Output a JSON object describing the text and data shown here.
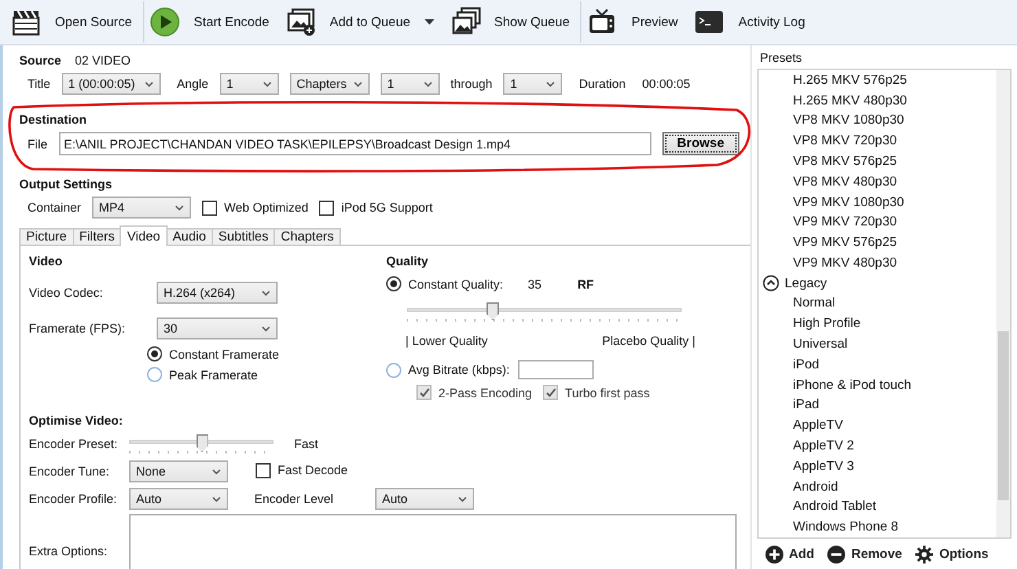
{
  "toolbar": [
    {
      "label": "Open Source",
      "dropdown": false
    },
    {
      "label": "Start Encode",
      "dropdown": false
    },
    {
      "label": "Add to Queue",
      "dropdown": true
    },
    {
      "label": "Show Queue",
      "dropdown": false
    },
    {
      "label": "Preview",
      "dropdown": false
    },
    {
      "label": "Activity Log",
      "dropdown": false
    }
  ],
  "source": {
    "label": "Source",
    "value": "02 VIDEO",
    "title_label": "Title",
    "title": "1 (00:00:05)",
    "angle_label": "Angle",
    "angle": "1",
    "range_mode": "Chapters",
    "range_start": "1",
    "through_label": "through",
    "range_end": "1",
    "duration_label": "Duration",
    "duration": "00:00:05"
  },
  "destination": {
    "label": "Destination",
    "file_label": "File",
    "file": "E:\\ANIL PROJECT\\CHANDAN VIDEO TASK\\EPILEPSY\\Broadcast Design 1.mp4",
    "browse": "Browse",
    "annotated": true
  },
  "output": {
    "label": "Output Settings",
    "container_label": "Container",
    "container": "MP4",
    "options": [
      {
        "label": "Web Optimized",
        "checked": false
      },
      {
        "label": "iPod 5G Support",
        "checked": false
      }
    ]
  },
  "tabs": [
    {
      "label": "Picture",
      "selected": false
    },
    {
      "label": "Filters",
      "selected": false
    },
    {
      "label": "Video",
      "selected": true
    },
    {
      "label": "Audio",
      "selected": false
    },
    {
      "label": "Subtitles",
      "selected": false
    },
    {
      "label": "Chapters",
      "selected": false
    }
  ],
  "video": {
    "heading": "Video",
    "codec_label": "Video Codec:",
    "codec": "H.264 (x264)",
    "fps_label": "Framerate (FPS):",
    "fps": "30",
    "rate_modes": [
      {
        "label": "Constant Framerate",
        "selected": true
      },
      {
        "label": "Peak Framerate",
        "selected": false
      }
    ]
  },
  "quality": {
    "heading": "Quality",
    "modes": [
      {
        "label": "Constant Quality:",
        "selected": true
      },
      {
        "label": "Avg Bitrate (kbps):",
        "selected": false
      }
    ],
    "value": "35",
    "unit": "RF",
    "level": 0.31,
    "low_label": "| Lower Quality",
    "high_label": "Placebo Quality |",
    "passes": [
      {
        "label": "2-Pass Encoding",
        "checked": true,
        "disabled": true
      },
      {
        "label": "Turbo first pass",
        "checked": true,
        "disabled": true
      }
    ]
  },
  "optimise": {
    "heading": "Optimise Video:",
    "preset_label": "Encoder Preset:",
    "level": 0.5,
    "preset_value": "Fast",
    "tune_label": "Encoder Tune:",
    "tune": "None",
    "fast_decode": {
      "label": "Fast Decode",
      "checked": false
    },
    "profile_label": "Encoder Profile:",
    "profile": "Auto",
    "level_label": "Encoder Level",
    "level_value": "Auto",
    "extra_label": "Extra Options:"
  },
  "presets": {
    "label": "Presets",
    "items": [
      {
        "kind": "item",
        "label": "H.265 MKV 576p25"
      },
      {
        "kind": "item",
        "label": "H.265 MKV 480p30"
      },
      {
        "kind": "item",
        "label": "VP8 MKV 1080p30"
      },
      {
        "kind": "item",
        "label": "VP8 MKV 720p30"
      },
      {
        "kind": "item",
        "label": "VP8 MKV 576p25"
      },
      {
        "kind": "item",
        "label": "VP8 MKV 480p30"
      },
      {
        "kind": "item",
        "label": "VP9 MKV 1080p30"
      },
      {
        "kind": "item",
        "label": "VP9 MKV 720p30"
      },
      {
        "kind": "item",
        "label": "VP9 MKV 576p25"
      },
      {
        "kind": "item",
        "label": "VP9 MKV 480p30"
      },
      {
        "kind": "group",
        "label": "Legacy",
        "expanded": true
      },
      {
        "kind": "item",
        "label": "Normal"
      },
      {
        "kind": "item",
        "label": "High Profile"
      },
      {
        "kind": "item",
        "label": "Universal"
      },
      {
        "kind": "item",
        "label": "iPod"
      },
      {
        "kind": "item",
        "label": "iPhone & iPod touch"
      },
      {
        "kind": "item",
        "label": "iPad"
      },
      {
        "kind": "item",
        "label": "AppleTV"
      },
      {
        "kind": "item",
        "label": "AppleTV 2"
      },
      {
        "kind": "item",
        "label": "AppleTV 3"
      },
      {
        "kind": "item",
        "label": "Android"
      },
      {
        "kind": "item",
        "label": "Android Tablet"
      },
      {
        "kind": "item",
        "label": "Windows Phone 8"
      }
    ],
    "actions": [
      {
        "label": "Add"
      },
      {
        "label": "Remove"
      },
      {
        "label": "Options"
      }
    ]
  }
}
